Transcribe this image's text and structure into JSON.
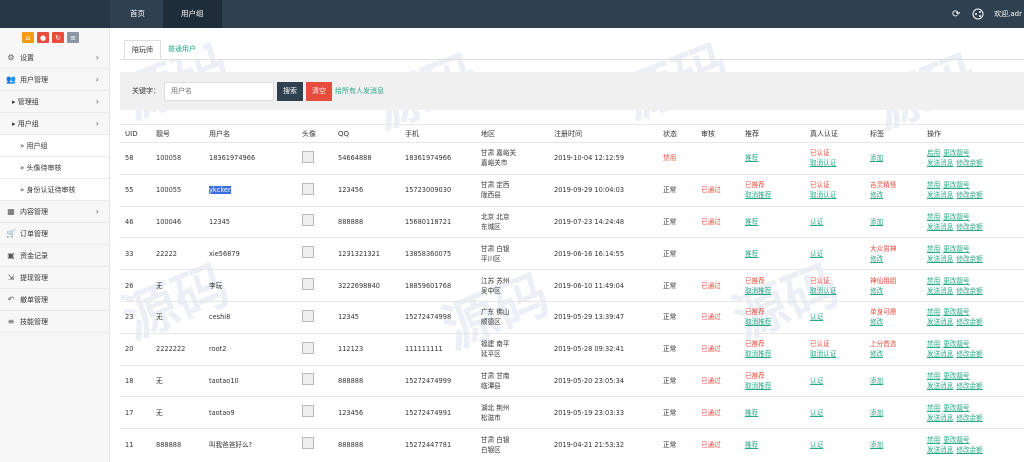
{
  "topbar": {
    "nav": [
      "首页",
      "用户组"
    ],
    "welcome": "欢迎,adr"
  },
  "sidebar": {
    "items": [
      {
        "label": "设置",
        "icon": "gears-icon",
        "arrow": true,
        "level": 0
      },
      {
        "label": "用户管理",
        "icon": "users-icon",
        "arrow": true,
        "level": 0
      },
      {
        "label": "▸ 管理组",
        "icon": "",
        "arrow": true,
        "level": 1
      },
      {
        "label": "▸ 用户组",
        "icon": "",
        "arrow": true,
        "level": 1
      },
      {
        "label": "» 用户组",
        "icon": "",
        "arrow": false,
        "level": 2
      },
      {
        "label": "» 头像待审核",
        "icon": "",
        "arrow": false,
        "level": 2
      },
      {
        "label": "» 身份认证待审核",
        "icon": "",
        "arrow": false,
        "level": 2
      },
      {
        "label": "内容管理",
        "icon": "grid-icon",
        "arrow": true,
        "level": 0
      },
      {
        "label": "订单管理",
        "icon": "cart-icon",
        "arrow": false,
        "level": 0
      },
      {
        "label": "资金记录",
        "icon": "money-icon",
        "arrow": false,
        "level": 0
      },
      {
        "label": "提现管理",
        "icon": "withdraw-icon",
        "arrow": false,
        "level": 0
      },
      {
        "label": "撤单管理",
        "icon": "undo-icon",
        "arrow": false,
        "level": 0
      },
      {
        "label": "技能管理",
        "icon": "list-icon",
        "arrow": false,
        "level": 0
      }
    ]
  },
  "tabs": [
    "陪玩师",
    "普通用户"
  ],
  "search": {
    "label": "关键字：",
    "placeholder": "用户名",
    "search_btn": "搜索",
    "clear_btn": "清空",
    "message": "给所有人发消息"
  },
  "table": {
    "headers": [
      "UID",
      "靓号",
      "用户名",
      "头像",
      "QQ",
      "手机",
      "地区",
      "注册时间",
      "状态",
      "审核",
      "推荐",
      "真人认证",
      "标签",
      "操作"
    ],
    "rows": [
      {
        "uid": "58",
        "num": "100058",
        "name": "18361974966",
        "qq": "54664888",
        "phone": "18361974966",
        "region": [
          "甘肃 嘉峪关",
          "嘉峪关市"
        ],
        "time": "2019-10-04 12:12:59",
        "status": "禁用",
        "status_red": true,
        "audit": "",
        "rec": [
          "推荐"
        ],
        "rec_red": [
          false
        ],
        "auth": [
          "已认证",
          "取消认证"
        ],
        "auth_red": [
          true,
          false
        ],
        "tag": [
          "添加"
        ],
        "tag_red": [
          false
        ]
      },
      {
        "uid": "55",
        "num": "100055",
        "name": "ykcker",
        "name_hl": true,
        "qq": "123456",
        "phone": "15723009030",
        "region": [
          "甘肃 定西",
          "陇西县"
        ],
        "time": "2019-09-29 10:04:03",
        "status": "正常",
        "status_red": false,
        "audit": "已通过",
        "rec": [
          "已推荐",
          "取消推荐"
        ],
        "rec_red": [
          true,
          false
        ],
        "auth": [
          "已认证",
          "取消认证"
        ],
        "auth_red": [
          true,
          false
        ],
        "tag": [
          "吉灵精怪",
          "修改"
        ],
        "tag_red": [
          true,
          false
        ]
      },
      {
        "uid": "46",
        "num": "100046",
        "name": "12345",
        "qq": "888888",
        "phone": "15680118721",
        "region": [
          "北京 北京",
          "东城区"
        ],
        "time": "2019-07-23 14:24:48",
        "status": "正常",
        "status_red": false,
        "audit": "已通过",
        "rec": [
          "推荐"
        ],
        "rec_red": [
          false
        ],
        "auth": [
          "认证"
        ],
        "auth_red": [
          false
        ],
        "tag": [
          "添加"
        ],
        "tag_red": [
          false
        ]
      },
      {
        "uid": "33",
        "num": "22222",
        "name": "xie56879",
        "qq": "1231321321",
        "phone": "13858360075",
        "region": [
          "甘肃 白银",
          "平川区"
        ],
        "time": "2019-06-16 16:14:55",
        "status": "正常",
        "status_red": false,
        "audit": "",
        "rec": [
          "推荐"
        ],
        "rec_red": [
          false
        ],
        "auth": [
          "认证"
        ],
        "auth_red": [
          false
        ],
        "tag": [
          "大众男神",
          "修改"
        ],
        "tag_red": [
          true,
          false
        ]
      },
      {
        "uid": "26",
        "num": "无",
        "name": "李玩",
        "qq": "3222698840",
        "phone": "18859601768",
        "region": [
          "江苏 苏州",
          "吴中区"
        ],
        "time": "2019-06-10 11:49:04",
        "status": "正常",
        "status_red": false,
        "audit": "已通过",
        "rec": [
          "已推荐",
          "取消推荐"
        ],
        "rec_red": [
          true,
          false
        ],
        "auth": [
          "已认证",
          "取消认证"
        ],
        "auth_red": [
          true,
          false
        ],
        "tag": [
          "神仙姐姐",
          "修改"
        ],
        "tag_red": [
          true,
          false
        ]
      },
      {
        "uid": "23",
        "num": "无",
        "name": "ceshi8",
        "qq": "12345",
        "phone": "15272474998",
        "region": [
          "广东 佛山",
          "顺德区"
        ],
        "time": "2019-05-29 13:39:47",
        "status": "正常",
        "status_red": false,
        "audit": "已通过",
        "rec": [
          "已推荐",
          "取消推荐"
        ],
        "rec_red": [
          true,
          false
        ],
        "auth": [
          "认证"
        ],
        "auth_red": [
          false
        ],
        "tag": [
          "单身可撩",
          "修改"
        ],
        "tag_red": [
          true,
          false
        ]
      },
      {
        "uid": "20",
        "num": "2222222",
        "name": "root2",
        "qq": "112123",
        "phone": "111111111",
        "region": [
          "福建 南平",
          "延平区"
        ],
        "time": "2019-05-28 09:32:41",
        "status": "正常",
        "status_red": false,
        "audit": "已通过",
        "rec": [
          "已推荐",
          "取消推荐"
        ],
        "rec_red": [
          true,
          false
        ],
        "auth": [
          "已认证",
          "取消认证"
        ],
        "auth_red": [
          true,
          false
        ],
        "tag": [
          "上分首选",
          "修改"
        ],
        "tag_red": [
          true,
          false
        ]
      },
      {
        "uid": "18",
        "num": "无",
        "name": "taotao10",
        "qq": "888888",
        "phone": "15272474999",
        "region": [
          "甘肃 甘南",
          "临潭县"
        ],
        "time": "2019-05-20 23:05:34",
        "status": "正常",
        "status_red": false,
        "audit": "已通过",
        "rec": [
          "已推荐",
          "取消推荐"
        ],
        "rec_red": [
          true,
          false
        ],
        "auth": [
          "认证"
        ],
        "auth_red": [
          false
        ],
        "tag": [
          "添加"
        ],
        "tag_red": [
          false
        ]
      },
      {
        "uid": "17",
        "num": "无",
        "name": "taotao9",
        "qq": "123456",
        "phone": "15272474991",
        "region": [
          "湖北 荆州",
          "松滋市"
        ],
        "time": "2019-05-19 23:03:33",
        "status": "正常",
        "status_red": false,
        "audit": "已通过",
        "rec": [
          "推荐"
        ],
        "rec_red": [
          false
        ],
        "auth": [
          "认证"
        ],
        "auth_red": [
          false
        ],
        "tag": [
          "添加"
        ],
        "tag_red": [
          false
        ]
      },
      {
        "uid": "11",
        "num": "888888",
        "name": "叫我爸爸好么?",
        "qq": "888888",
        "phone": "15272447781",
        "region": [
          "甘肃 白银",
          "白银区"
        ],
        "time": "2019-04-21 21:53:32",
        "status": "正常",
        "status_red": false,
        "audit": "已通过",
        "rec": [
          "推荐"
        ],
        "rec_red": [
          false
        ],
        "auth": [
          "认证"
        ],
        "auth_red": [
          false
        ],
        "tag": [
          "添加"
        ],
        "tag_red": [
          false
        ]
      }
    ],
    "ops": [
      [
        "禁用",
        "更改靓号"
      ],
      [
        "发送消息",
        "修改余额"
      ]
    ],
    "ops_row0": [
      [
        "启用",
        "更改靓号"
      ],
      [
        "发送消息",
        "修改余额"
      ]
    ]
  },
  "watermark": "源码"
}
